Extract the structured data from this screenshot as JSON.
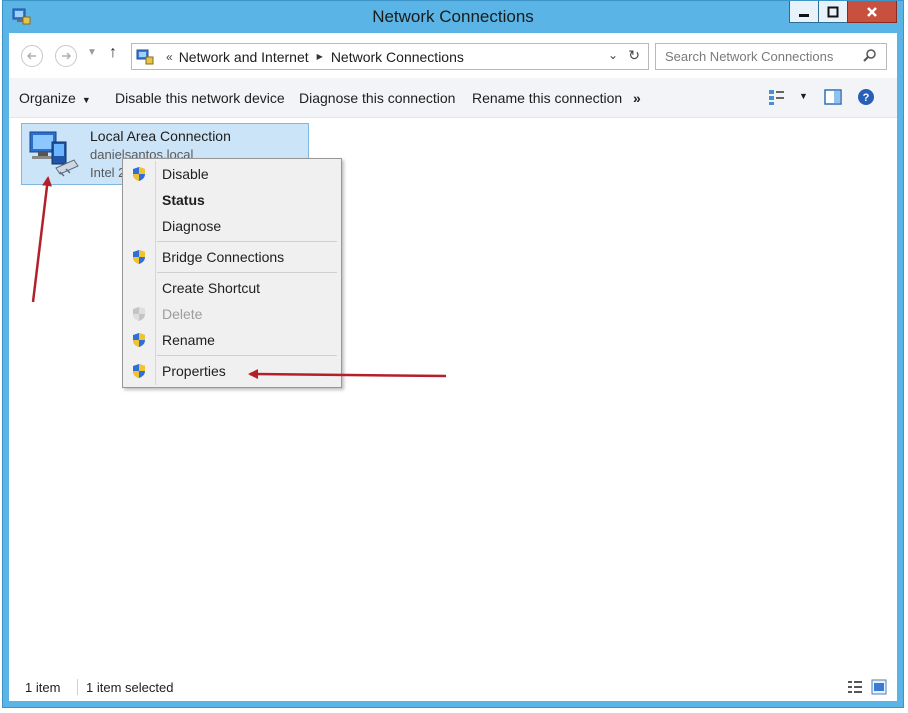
{
  "window": {
    "title": "Network Connections"
  },
  "address": {
    "overflow": "«",
    "crumbs": [
      "Network and Internet",
      "Network Connections"
    ]
  },
  "search": {
    "placeholder": "Search Network Connections"
  },
  "toolbar": {
    "organize": "Organize",
    "disable": "Disable this network device",
    "diagnose": "Diagnose this connection",
    "rename": "Rename this connection",
    "more": "»"
  },
  "item": {
    "name": "Local Area Connection",
    "domain": "danielsantos.local",
    "device": "Intel 2"
  },
  "context_menu": {
    "items": [
      {
        "label": "Disable",
        "shield": true
      },
      {
        "label": "Status",
        "bold": true
      },
      {
        "label": "Diagnose"
      },
      {
        "label": "Bridge Connections",
        "shield": true
      },
      {
        "label": "Create Shortcut"
      },
      {
        "label": "Delete",
        "shield": true,
        "disabled": true
      },
      {
        "label": "Rename",
        "shield": true
      },
      {
        "label": "Properties",
        "shield": true
      }
    ]
  },
  "statusbar": {
    "count": "1 item",
    "selected": "1 item selected"
  },
  "colors": {
    "titlebar": "#5ab4e6",
    "selection": "#cce4f7",
    "annotation_arrow": "#b3202a"
  }
}
